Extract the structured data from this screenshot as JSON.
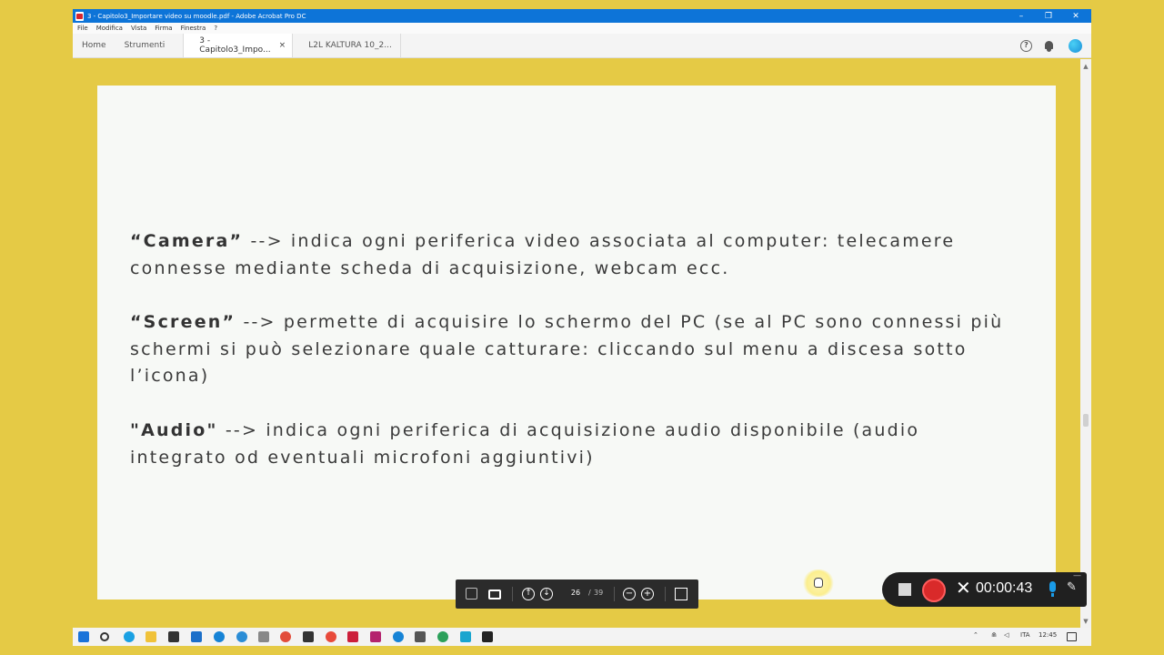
{
  "window": {
    "title": "3 - Capitolo3_Importare video su moodle.pdf - Adobe Acrobat Pro DC",
    "controls": [
      "–",
      "❐",
      "✕"
    ]
  },
  "menu": [
    "File",
    "Modifica",
    "Vista",
    "Firma",
    "Finestra",
    "?"
  ],
  "tabs": {
    "home": "Home",
    "tools": "Strumenti",
    "doc1": "3 - Capitolo3_Impo...",
    "doc1_close": "×",
    "doc2": "L2L KALTURA 10_2..."
  },
  "header_icons": {
    "help": "?"
  },
  "scroll": {
    "up": "▲",
    "down": "▼"
  },
  "page": {
    "p1_term": "“Camera”",
    "p1_text": " --> indica ogni periferica video associata al computer: telecamere connesse mediante scheda di acquisizione, webcam ecc.",
    "p2_term": "“Screen”",
    "p2_text": " --> permette di acquisire lo schermo del PC (se al PC sono connessi più schermi si può selezionare quale catturare: cliccando sul menu a discesa sotto l’icona)",
    "p3_term": "\"Audio\"",
    "p3_text": " --> indica ogni periferica di acquisizione audio disponibile (audio integrato od eventuali microfoni aggiuntivi)"
  },
  "pdf_toolbar": {
    "current_page": "26",
    "separator": "/",
    "total_pages": "39",
    "up": "↑",
    "down": "↓",
    "zoom_out": "−",
    "zoom_in": "+"
  },
  "recorder": {
    "time": "00:00:43",
    "close": "✕",
    "pen": "✎",
    "minimize": "—"
  },
  "taskbar": {
    "lang": "ITA",
    "clock": "12:45"
  }
}
